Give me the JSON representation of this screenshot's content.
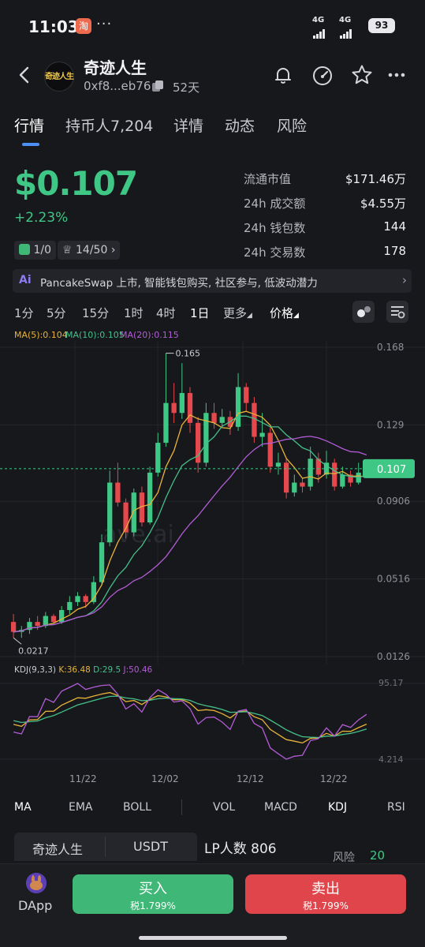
{
  "status_bar": {
    "time": "11:03",
    "app_badge": "淘",
    "dots": "···",
    "net1": "4G",
    "net2": "4G",
    "battery": "93"
  },
  "header": {
    "token_name": "奇迹人生",
    "avatar_text": "奇迹人生",
    "address": "0xf8...eb76",
    "age": "52天"
  },
  "tabs": [
    {
      "label": "行情"
    },
    {
      "label": "持币人7,204"
    },
    {
      "label": "详情"
    },
    {
      "label": "动态"
    },
    {
      "label": "风险"
    }
  ],
  "price": {
    "value": "$0.107",
    "change": "+2.23%",
    "chip1_value": "1/0",
    "chip2_value": "14/50"
  },
  "stats": [
    {
      "label": "流通市值",
      "value": "$171.46万"
    },
    {
      "label": "24h 成交额",
      "value": "$4.55万"
    },
    {
      "label": "24h 钱包数",
      "value": "144"
    },
    {
      "label": "24h 交易数",
      "value": "178"
    }
  ],
  "ai_banner": {
    "badge": "Ai",
    "text": "PancakeSwap 上市, 智能钱包购买, 社区参与, 低波动潜力"
  },
  "intervals": [
    "1分",
    "5分",
    "15分",
    "1时",
    "4时",
    "1日",
    "更多",
    "价格"
  ],
  "ma_legend": {
    "ma5": "MA(5):0.104",
    "ma10": "MA(10):0.105",
    "ma20": "MA(20):0.115"
  },
  "colors": {
    "up": "#3fc785",
    "down": "#e5484d",
    "ma5": "#e8b339",
    "ma10": "#45c08a",
    "ma20": "#b35cd6",
    "accent": "#4c8ff5"
  },
  "chart_data": {
    "type": "candlestick",
    "y_ticks": [
      "0.168",
      "0.129",
      "0.0906",
      "0.0516",
      "0.0126"
    ],
    "ylim": [
      0.0126,
      0.168
    ],
    "current_price": "0.107",
    "high_label": "0.165",
    "low_label": "0.0217",
    "watermark": "ave.ai",
    "x_ticks": [
      "11/22",
      "12/02",
      "12/12",
      "12/22"
    ],
    "candles": [
      [
        0.03,
        0.025,
        0.034,
        0.022
      ],
      [
        0.025,
        0.026,
        0.028,
        0.022
      ],
      [
        0.026,
        0.03,
        0.032,
        0.024
      ],
      [
        0.03,
        0.028,
        0.033,
        0.026
      ],
      [
        0.028,
        0.033,
        0.035,
        0.027
      ],
      [
        0.033,
        0.03,
        0.034,
        0.029
      ],
      [
        0.03,
        0.036,
        0.038,
        0.029
      ],
      [
        0.036,
        0.04,
        0.043,
        0.034
      ],
      [
        0.04,
        0.043,
        0.045,
        0.038
      ],
      [
        0.043,
        0.04,
        0.044,
        0.037
      ],
      [
        0.04,
        0.05,
        0.053,
        0.039
      ],
      [
        0.05,
        0.07,
        0.074,
        0.049
      ],
      [
        0.07,
        0.1,
        0.106,
        0.068
      ],
      [
        0.1,
        0.09,
        0.11,
        0.088
      ],
      [
        0.09,
        0.075,
        0.092,
        0.072
      ],
      [
        0.075,
        0.095,
        0.097,
        0.073
      ],
      [
        0.095,
        0.08,
        0.098,
        0.078
      ],
      [
        0.08,
        0.105,
        0.108,
        0.079
      ],
      [
        0.105,
        0.12,
        0.125,
        0.103
      ],
      [
        0.12,
        0.14,
        0.165,
        0.118
      ],
      [
        0.14,
        0.135,
        0.15,
        0.13
      ],
      [
        0.135,
        0.145,
        0.16,
        0.132
      ],
      [
        0.145,
        0.13,
        0.148,
        0.125
      ],
      [
        0.13,
        0.11,
        0.133,
        0.105
      ],
      [
        0.11,
        0.135,
        0.14,
        0.108
      ],
      [
        0.135,
        0.13,
        0.14,
        0.127
      ],
      [
        0.13,
        0.133,
        0.137,
        0.128
      ],
      [
        0.133,
        0.128,
        0.136,
        0.124
      ],
      [
        0.128,
        0.148,
        0.155,
        0.126
      ],
      [
        0.148,
        0.14,
        0.15,
        0.136
      ],
      [
        0.14,
        0.123,
        0.143,
        0.12
      ],
      [
        0.123,
        0.125,
        0.135,
        0.118
      ],
      [
        0.125,
        0.108,
        0.128,
        0.105
      ],
      [
        0.108,
        0.11,
        0.115,
        0.104
      ],
      [
        0.11,
        0.095,
        0.112,
        0.092
      ],
      [
        0.095,
        0.1,
        0.104,
        0.093
      ],
      [
        0.1,
        0.098,
        0.102,
        0.095
      ],
      [
        0.098,
        0.112,
        0.118,
        0.096
      ],
      [
        0.112,
        0.104,
        0.115,
        0.1
      ],
      [
        0.104,
        0.11,
        0.116,
        0.102
      ],
      [
        0.11,
        0.098,
        0.112,
        0.096
      ],
      [
        0.098,
        0.104,
        0.108,
        0.097
      ],
      [
        0.104,
        0.1,
        0.106,
        0.098
      ],
      [
        0.1,
        0.105,
        0.11,
        0.099
      ],
      [
        0.105,
        0.107,
        0.109,
        0.104
      ]
    ],
    "kdj_legend": {
      "label": "KDJ(9,3,3)",
      "k": "K:36.48",
      "d": "D:29.5",
      "j": "J:50.46"
    },
    "kdj_ticks": [
      "95.17",
      "4.214"
    ]
  },
  "indicators": [
    "MA",
    "EMA",
    "BOLL",
    "VOL",
    "MACD",
    "KDJ",
    "RSI"
  ],
  "bottom_panel": {
    "pair_left": "奇迹人生",
    "pair_right": "USDT",
    "lp_count": "LP人数  806",
    "risk_label": "风险",
    "risk_value": "20"
  },
  "actions": {
    "dapp_label": "DApp",
    "buy_label": "买入",
    "buy_tax": "税1.799%",
    "sell_label": "卖出",
    "sell_tax": "税1.799%"
  }
}
